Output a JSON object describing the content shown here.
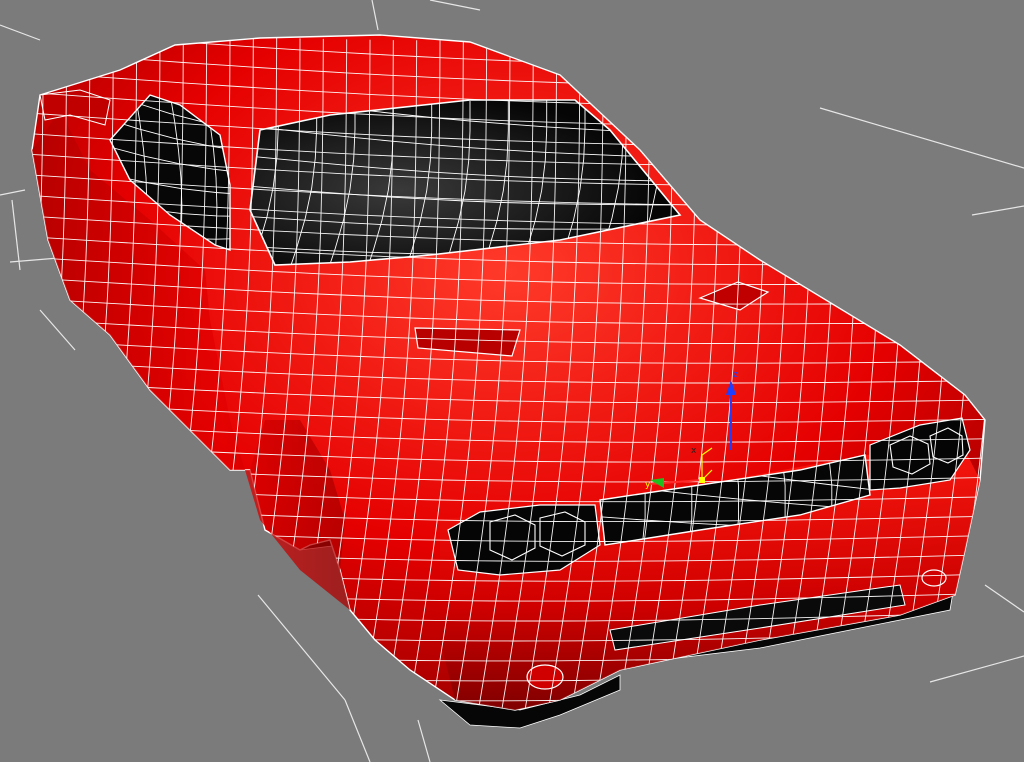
{
  "viewport": {
    "background": "#7b7b7b",
    "grid_color": "#e8e8e8",
    "wire_color": "#ffffff"
  },
  "model": {
    "body_color": "#e50000",
    "body_highlight": "#ff3a2a",
    "body_shadow": "#9a0000",
    "glass_color": "#050505",
    "glass_sheen": "#3a3a3a"
  },
  "gizmo": {
    "icon": "transform-gizmo-icon",
    "x_label": "x",
    "y_label": "y",
    "z_label": "z",
    "x_color": "#ff2a2a",
    "y_color": "#1fbf1f",
    "z_color": "#1f3fff",
    "center_color": "#ffff00"
  }
}
